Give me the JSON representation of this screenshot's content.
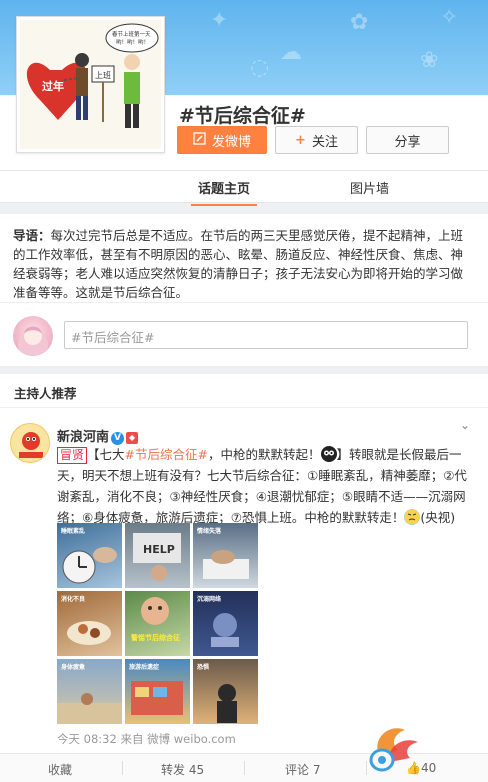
{
  "topic": {
    "title": "#节后综合征#",
    "cover_bubble": "春节上班第一天 哟！哟！哟！",
    "cover_sign": "上班",
    "cover_label": "过年"
  },
  "buttons": {
    "post": "发微博",
    "follow": "关注",
    "share": "分享"
  },
  "tabs": [
    {
      "label": "话题主页",
      "active": true
    },
    {
      "label": "图片墙",
      "active": false
    }
  ],
  "intro": {
    "label": "导语：",
    "text": "每次过完节后总是不适应。在节后的两三天里感觉厌倦，提不起精神，上班的工作效率低，甚至有不明原因的恶心、眩晕、肠道反应、神经性厌食、焦虑、神经衰弱等；老人难以适应突然恢复的清静日子；孩子无法安心为即将开始的学习做准备等等。这就是节后综合征。"
  },
  "composer": {
    "placeholder": "#节后综合征#"
  },
  "section": {
    "title": "主持人推荐"
  },
  "post": {
    "author": "新浪河南",
    "tag": "冒贤",
    "text_lead": "【七大",
    "topic_link": "#节后综合征#",
    "text_mid": "，中枪的默默转起！",
    "text_body": "】转眼就是长假最后一天，明天不想上班有没有？七大节后综合征：①睡眠紊乱，精神萎靡；②代谢紊乱，消化不良；③神经性厌食；④退潮忧郁症；⑤眼睛不适——沉溺网络；⑥身体疲惫，旅游后遗症；⑦恐惧上班。中枪的默默转走！",
    "text_tail": "(央视)",
    "timestamp": "今天 08:32 来自 微博 weibo.com",
    "thumbs": [
      {
        "caption": "睡眠紊乱"
      },
      {
        "caption": ""
      },
      {
        "caption": "情绪失落"
      },
      {
        "caption": "消化不良"
      },
      {
        "caption": "警惕节后综合征"
      },
      {
        "caption": "沉溺网络"
      },
      {
        "caption": "身体疲惫"
      },
      {
        "caption": "旅游后遗症"
      },
      {
        "caption": "恐惧"
      }
    ]
  },
  "actions": {
    "collect": "收藏",
    "forward": "转发 45",
    "comment": "评论 7",
    "like": "40"
  },
  "colors": {
    "accent": "#ff8140",
    "link": "#eb7350",
    "banner": "#6fbdf0"
  }
}
